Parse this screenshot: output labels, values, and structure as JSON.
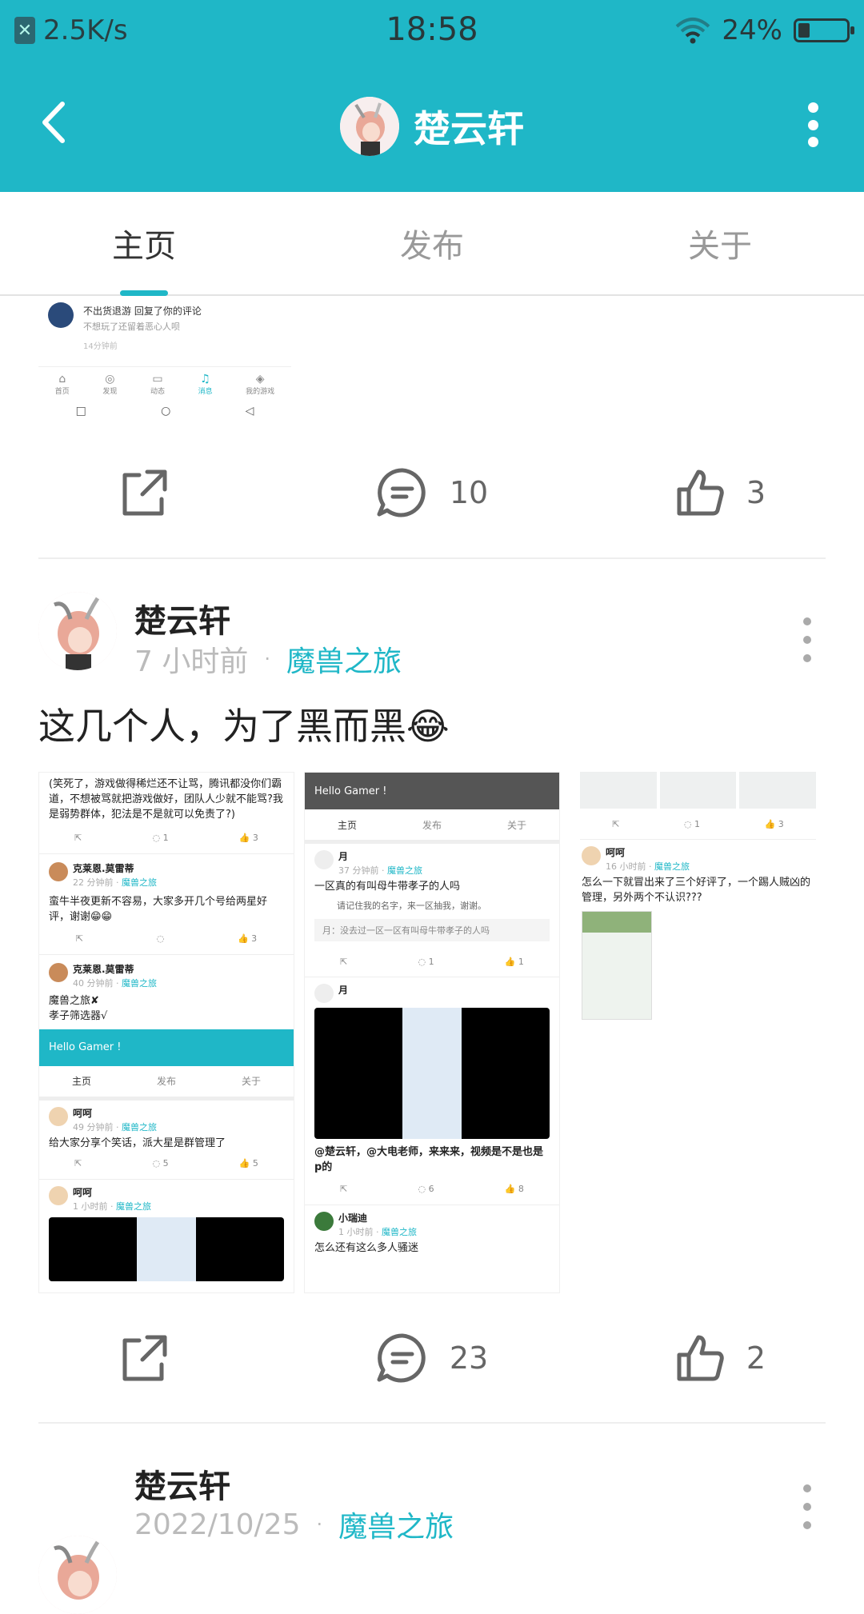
{
  "status": {
    "net_speed": "2.5K/s",
    "time": "18:58",
    "battery": "24%",
    "battery_level": 0.24
  },
  "header": {
    "title": "楚云轩"
  },
  "tabs": [
    {
      "label": "主页",
      "active": true
    },
    {
      "label": "发布",
      "active": false
    },
    {
      "label": "关于",
      "active": false
    }
  ],
  "top_shot": {
    "notif_title": "不出货退游 回复了你的评论",
    "notif_body": "不想玩了还留着恶心人呗",
    "notif_time": "14分钟前",
    "nav": [
      "首页",
      "发现",
      "动态",
      "消息",
      "我的游戏"
    ]
  },
  "post1_actions": {
    "comments": "10",
    "likes": "3"
  },
  "post2": {
    "author": "楚云轩",
    "time": "7 小时前",
    "game": "魔兽之旅",
    "text": "这几个人，为了黑而黑😂",
    "actions": {
      "comments": "23",
      "likes": "2"
    }
  },
  "img1": {
    "top_text": "(笑死了，游戏做得稀烂还不让骂，腾讯都没你们霸道，不想被骂就把游戏做好，团队人少就不能骂?我是弱势群体，犯法是不是就可以免责了?)",
    "a1": "1",
    "l1": "3",
    "u2": "克莱恩.莫雷蒂",
    "t2": "22 分钟前",
    "g2": "魔兽之旅",
    "body2": "蛮牛半夜更新不容易，大家多开几个号给两星好评，谢谢😁😁",
    "l2": "3",
    "u3": "克莱恩.莫雷蒂",
    "t3": "40 分钟前",
    "g3": "魔兽之旅",
    "body3a": "魔兽之旅✘",
    "body3b": "孝子筛选器√",
    "bar": "Hello Gamer !",
    "tabs": [
      "主页",
      "发布",
      "关于"
    ],
    "u4": "呵呵",
    "t4": "49 分钟前",
    "g4": "魔兽之旅",
    "body4": "给大家分享个笑话，派大星是群管理了",
    "c4": "5",
    "l4": "5",
    "u5": "呵呵",
    "t5": "1 小时前",
    "g5": "魔兽之旅"
  },
  "img2": {
    "bar": "Hello Gamer !",
    "tabs": [
      "主页",
      "发布",
      "关于"
    ],
    "u1": "月",
    "t1": "37 分钟前",
    "g1": "魔兽之旅",
    "body1": "一区真的有叫母牛带孝子的人吗",
    "hand1": "请记住我的名字，来一区抽我，谢谢。",
    "hand2": "月：没去过一区一区有叫母牛带孝子的人吗",
    "c1": "1",
    "l1": "1",
    "u2": "月",
    "body2": "@楚云轩，@大电老师，来来来，视频是不是也是p的",
    "c2": "6",
    "l2": "8",
    "u3": "小瑞迪",
    "t3": "1 小时前",
    "g3": "魔兽之旅",
    "body3": "怎么还有这么多人骚迷"
  },
  "img3": {
    "c0": "1",
    "l0": "3",
    "u1": "呵呵",
    "t1": "16 小时前",
    "g1": "魔兽之旅",
    "body1": "怎么一下就冒出来了三个好评了，一个踢人贼凶的管理，另外两个不认识???"
  },
  "post3": {
    "author": "楚云轩",
    "time": "2022/10/25",
    "game": "魔兽之旅"
  }
}
